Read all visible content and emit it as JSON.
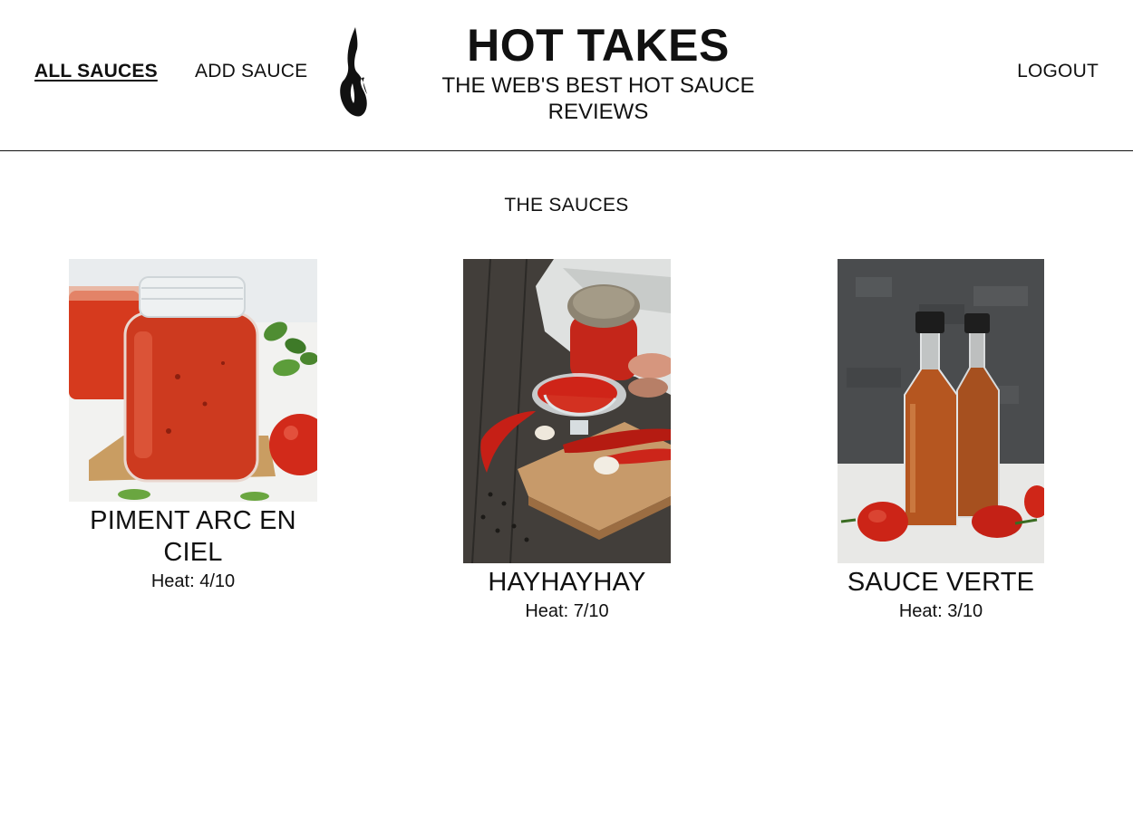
{
  "nav": {
    "all_sauces": "ALL SAUCES",
    "add_sauce": "ADD SAUCE",
    "logout": "LOGOUT"
  },
  "brand": {
    "title": "HOT TAKES",
    "subtitle": "THE WEB'S BEST HOT SAUCE REVIEWS",
    "logo_icon": "flame-icon"
  },
  "main": {
    "section_title": "THE SAUCES",
    "sauces": [
      {
        "name": "PIMENT ARC EN CIEL",
        "heat": "Heat: 4/10",
        "image": "mason-jar-red-sauce-photo"
      },
      {
        "name": "HAYHAYHAY",
        "heat": "Heat: 7/10",
        "image": "gravy-boat-red-sauce-photo"
      },
      {
        "name": "SAUCE VERTE",
        "heat": "Heat: 3/10",
        "image": "hot-sauce-bottles-photo"
      }
    ]
  }
}
